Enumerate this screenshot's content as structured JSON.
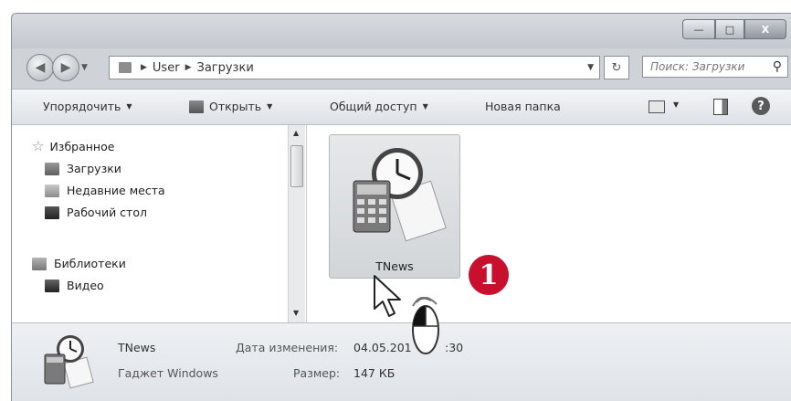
{
  "window": {
    "controls": {
      "minimize": "—",
      "maximize": "□",
      "close": "X"
    }
  },
  "address": {
    "segments": [
      "User",
      "Загрузки"
    ],
    "search_placeholder": "Поиск: Загрузки"
  },
  "toolbar": {
    "organize": "Упорядочить",
    "open": "Открыть",
    "share": "Общий доступ",
    "new_folder": "Новая папка"
  },
  "nav": {
    "favorites": "Избранное",
    "downloads": "Загрузки",
    "recent": "Недавние места",
    "desktop": "Рабочий стол",
    "libraries": "Библиотеки",
    "video": "Видео"
  },
  "file": {
    "name": "TNews"
  },
  "details": {
    "name": "TNews",
    "type": "Гаджет Windows",
    "modified_label": "Дата изменения:",
    "modified_value": "04.05.201",
    "modified_tail": ":30",
    "size_label": "Размер:",
    "size_value": "147 КБ"
  },
  "callout": "1",
  "colors": {
    "callout": "#c8102e",
    "window_bg": "#cfd3d8"
  }
}
